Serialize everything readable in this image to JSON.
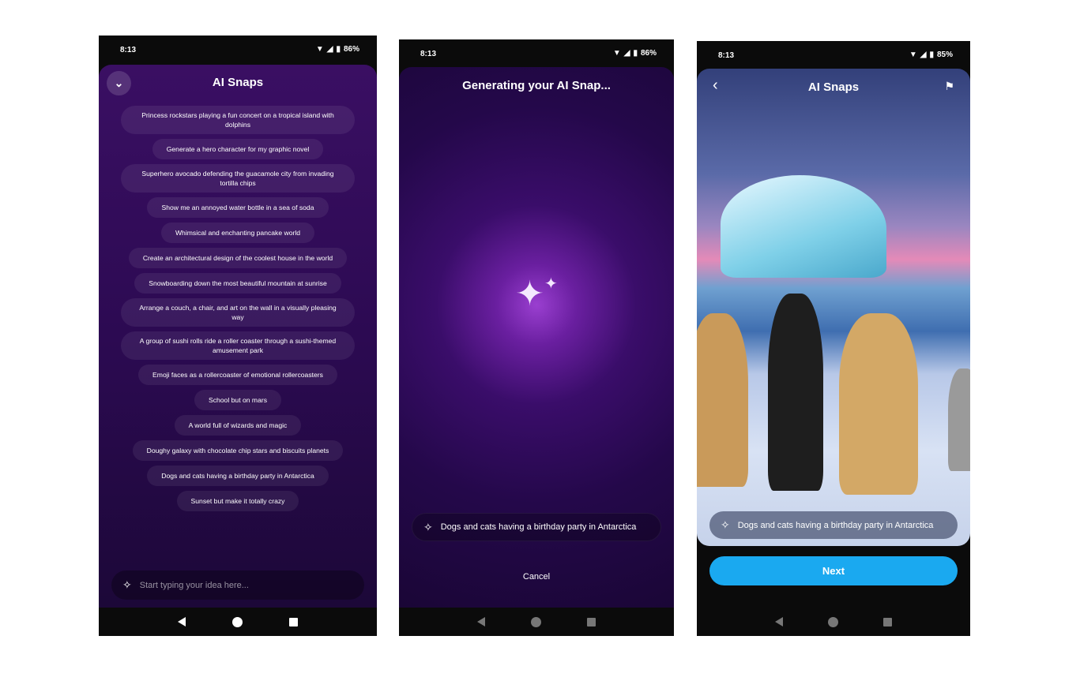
{
  "phone1": {
    "status": {
      "time": "8:13",
      "battery": "86%"
    },
    "title": "AI Snaps",
    "collapse_icon": "chevron-down-icon",
    "suggestions": [
      "Princess rockstars playing a fun concert on a tropical island with dolphins",
      "Generate a hero character for my graphic novel",
      "Superhero avocado defending the guacamole city from invading tortilla chips",
      "Show me an annoyed water bottle in a sea of soda",
      "Whimsical and enchanting pancake world",
      "Create an architectural design of the coolest house in the world",
      "Snowboarding down the most beautiful mountain at sunrise",
      "Arrange a couch, a chair, and art on the wall in a visually pleasing way",
      "A group of sushi rolls ride a roller coaster through a sushi-themed amusement park",
      "Emoji faces as a rollercoaster of emotional rollercoasters",
      "School but on mars",
      "A world full of wizards and magic",
      "Doughy galaxy with chocolate chip stars and biscuits planets",
      "Dogs and cats having a birthday party in Antarctica",
      "Sunset but make it totally crazy"
    ],
    "input_placeholder": "Start typing your idea here..."
  },
  "phone2": {
    "status": {
      "time": "8:13",
      "battery": "86%"
    },
    "title": "Generating your AI Snap...",
    "prompt": "Dogs and cats having a birthday party in Antarctica",
    "cancel_label": "Cancel"
  },
  "phone3": {
    "status": {
      "time": "8:13",
      "battery": "85%"
    },
    "title": "AI Snaps",
    "prompt": "Dogs and cats having a birthday party in Antarctica",
    "next_label": "Next",
    "accent": "#1aa9f0"
  }
}
